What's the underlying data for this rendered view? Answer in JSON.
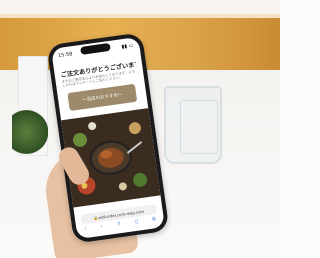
{
  "status_bar": {
    "time": "15:58"
  },
  "screen": {
    "greeting": "ご注文ありがとうございます。",
    "subtext": "またのご来店を心よりお待ちしております。よろしければアンケートにご協力ください。",
    "cta_label": "〜当店のおすすめ〜"
  },
  "browser": {
    "url": "self-order.com-map.com"
  },
  "icons": [
    "back-icon",
    "forward-icon",
    "share-icon",
    "bookmarks-icon",
    "tabs-icon"
  ]
}
